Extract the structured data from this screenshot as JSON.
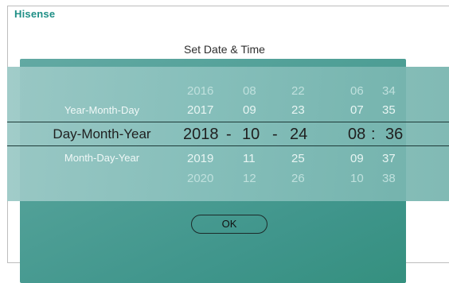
{
  "brand": "Hisense",
  "dialog": {
    "title": "Set Date & Time",
    "ok_label": "OK"
  },
  "formats": {
    "above": "Year-Month-Day",
    "selected": "Day-Month-Year",
    "below": "Month-Day-Year"
  },
  "columns": {
    "year": {
      "prev2": "2016",
      "prev1": "2017",
      "selected": "2018",
      "next1": "2019",
      "next2": "2020"
    },
    "month": {
      "prev2": "08",
      "prev1": "09",
      "selected": "10",
      "next1": "11",
      "next2": "12"
    },
    "day": {
      "prev2": "22",
      "prev1": "23",
      "selected": "24",
      "next1": "25",
      "next2": "26"
    },
    "hour": {
      "prev2": "06",
      "prev1": "07",
      "selected": "08",
      "next1": "09",
      "next2": "10"
    },
    "minute": {
      "prev2": "34",
      "prev1": "35",
      "selected": "36",
      "next1": "37",
      "next2": "38"
    }
  },
  "separators": {
    "date1": "-",
    "date2": "-",
    "time": ":"
  },
  "colors": {
    "brand": "#1f8f86",
    "panel": "#4f9f96",
    "selection_line": "#1e3a38"
  }
}
